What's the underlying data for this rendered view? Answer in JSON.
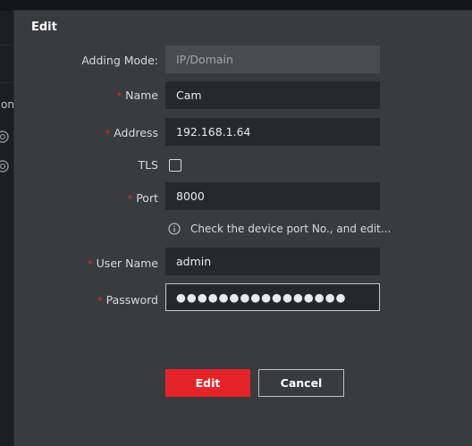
{
  "background": {
    "partial_text": "tion"
  },
  "dialog": {
    "title": "Edit",
    "fields": {
      "adding_mode": {
        "label": "Adding Mode:",
        "value": "IP/Domain"
      },
      "name": {
        "label": "Name",
        "required_mark": "*",
        "value": "Cam"
      },
      "address": {
        "label": "Address",
        "required_mark": "*",
        "value": "192.168.1.64"
      },
      "tls": {
        "label": "TLS",
        "checked": false
      },
      "port": {
        "label": "Port",
        "required_mark": "*",
        "value": "8000"
      },
      "port_hint": "Check the device port No., and edit...",
      "user_name": {
        "label": "User Name",
        "required_mark": "*",
        "value": "admin"
      },
      "password": {
        "label": "Password",
        "required_mark": "*",
        "value": "●●●●●●●●●●●●●●●●"
      }
    },
    "buttons": {
      "edit_label": "Edit",
      "cancel_label": "Cancel"
    }
  },
  "colors": {
    "accent": "#e5242a",
    "required": "#e22d33",
    "dialog_bg": "#3a3b3e",
    "field_bg": "#272829"
  }
}
